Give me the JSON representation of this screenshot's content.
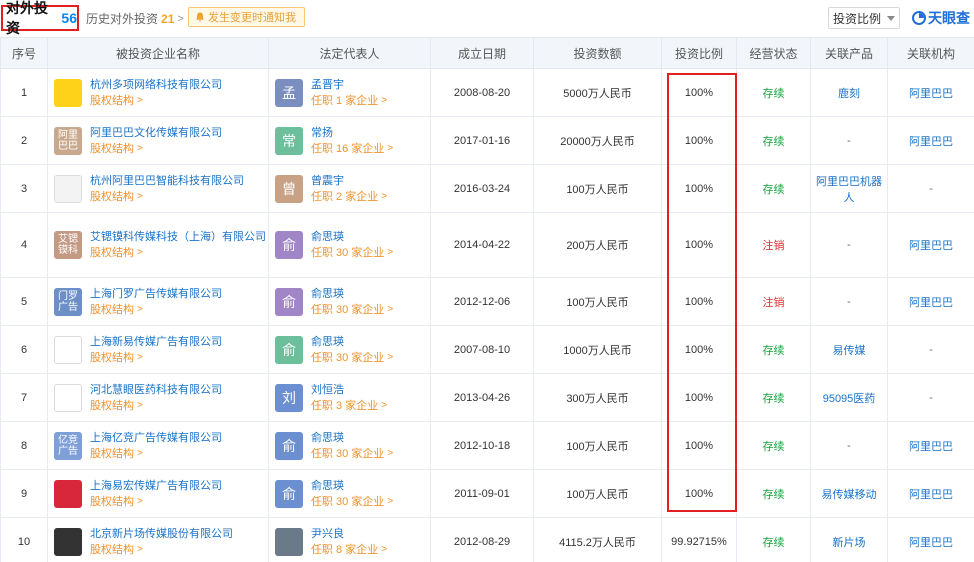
{
  "header": {
    "title": "对外投资",
    "count": "56",
    "history_label": "历史对外投资",
    "history_count": "21",
    "notify_label": "发生变更时通知我",
    "sort_label": "投资比例",
    "logo_text": "天眼查"
  },
  "columns": [
    "序号",
    "被投资企业名称",
    "法定代表人",
    "成立日期",
    "投资数额",
    "投资比例",
    "经营状态",
    "关联产品",
    "关联机构"
  ],
  "sub_label": "股权结构",
  "rows": [
    {
      "no": "1",
      "company": "杭州多项网络科技有限公司",
      "logo_text": "",
      "rep_avatar": "孟",
      "rep": "孟晋宇",
      "rep_roles": "任职 1 家企业",
      "date": "2008-08-20",
      "amount": "5000万人民币",
      "ratio": "100%",
      "status": "存续",
      "product": "鹿刻",
      "org": "阿里巴巴"
    },
    {
      "no": "2",
      "company": "阿里巴巴文化传媒有限公司",
      "logo_text": "阿里巴巴",
      "rep_avatar": "常",
      "rep": "常扬",
      "rep_roles": "任职 16 家企业",
      "date": "2017-01-16",
      "amount": "20000万人民币",
      "ratio": "100%",
      "status": "存续",
      "product": "-",
      "org": "阿里巴巴"
    },
    {
      "no": "3",
      "company": "杭州阿里巴巴智能科技有限公司",
      "logo_text": "",
      "rep_avatar": "曾",
      "rep": "曾震宇",
      "rep_roles": "任职 2 家企业",
      "date": "2016-03-24",
      "amount": "100万人民币",
      "ratio": "100%",
      "status": "存续",
      "product": "阿里巴巴机器人",
      "org": "-"
    },
    {
      "no": "4",
      "company": "艾锶镆科传媒科技（上海）有限公司",
      "logo_text": "艾锶镆科",
      "rep_avatar": "俞",
      "rep": "俞思瑛",
      "rep_roles": "任职 30 家企业",
      "date": "2014-04-22",
      "amount": "200万人民币",
      "ratio": "100%",
      "status": "注销",
      "product": "-",
      "org": "阿里巴巴"
    },
    {
      "no": "5",
      "company": "上海门罗广告传媒有限公司",
      "logo_text": "门罗广告",
      "rep_avatar": "俞",
      "rep": "俞思瑛",
      "rep_roles": "任职 30 家企业",
      "date": "2012-12-06",
      "amount": "100万人民币",
      "ratio": "100%",
      "status": "注销",
      "product": "-",
      "org": "阿里巴巴"
    },
    {
      "no": "6",
      "company": "上海新易传媒广告有限公司",
      "logo_text": "",
      "rep_avatar": "俞",
      "rep": "俞思瑛",
      "rep_roles": "任职 30 家企业",
      "date": "2007-08-10",
      "amount": "1000万人民币",
      "ratio": "100%",
      "status": "存续",
      "product": "易传媒",
      "org": "-"
    },
    {
      "no": "7",
      "company": "河北慧眼医药科技有限公司",
      "logo_text": "",
      "rep_avatar": "刘",
      "rep": "刘恒浩",
      "rep_roles": "任职 3 家企业",
      "date": "2013-04-26",
      "amount": "300万人民币",
      "ratio": "100%",
      "status": "存续",
      "product": "95095医药",
      "org": "-"
    },
    {
      "no": "8",
      "company": "上海亿竞广告传媒有限公司",
      "logo_text": "亿竞广告",
      "rep_avatar": "俞",
      "rep": "俞思瑛",
      "rep_roles": "任职 30 家企业",
      "date": "2012-10-18",
      "amount": "100万人民币",
      "ratio": "100%",
      "status": "存续",
      "product": "-",
      "org": "阿里巴巴"
    },
    {
      "no": "9",
      "company": "上海易宏传媒广告有限公司",
      "logo_text": "",
      "rep_avatar": "俞",
      "rep": "俞思瑛",
      "rep_roles": "任职 30 家企业",
      "date": "2011-09-01",
      "amount": "100万人民币",
      "ratio": "100%",
      "status": "存续",
      "product": "易传媒移动",
      "org": "阿里巴巴"
    },
    {
      "no": "10",
      "company": "北京新片场传媒股份有限公司",
      "logo_text": "",
      "rep_avatar": "",
      "rep": "尹兴良",
      "rep_roles": "任职 8 家企业",
      "date": "2012-08-29",
      "amount": "4115.2万人民币",
      "ratio": "99.92715%",
      "status": "存续",
      "product": "新片场",
      "org": "阿里巴巴"
    }
  ]
}
